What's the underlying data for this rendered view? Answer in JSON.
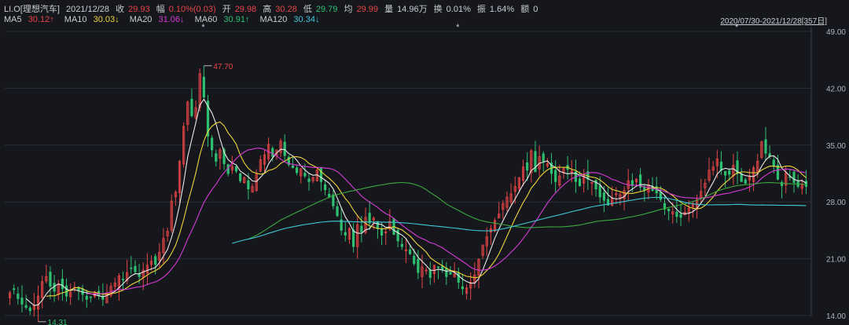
{
  "header": {
    "symbol": "LI.O[理想汽车]",
    "date": "2021/12/28",
    "close_label": "收",
    "close": "29.93",
    "change_label": "幅",
    "change": "0.10%(0.03)",
    "open_label": "开",
    "open": "29.98",
    "high_label": "高",
    "high": "30.28",
    "low_label": "低",
    "low": "29.79",
    "avg_label": "均",
    "avg": "29.99",
    "volume_label": "量",
    "volume": "14.96万",
    "turnover_label": "换",
    "turnover": "0.01%",
    "amplitude_label": "振",
    "amplitude": "1.64%",
    "amount_label": "额",
    "amount": "0"
  },
  "ma_legend": [
    {
      "name": "MA5",
      "value": "30.12↑",
      "color": "#e9e9e9",
      "value_color": "#e64545"
    },
    {
      "name": "MA10",
      "value": "30.03↓",
      "color": "#e9e9e9",
      "value_color": "#f0d43a"
    },
    {
      "name": "MA20",
      "value": "31.06↓",
      "color": "#e9e9e9",
      "value_color": "#d63ad6"
    },
    {
      "name": "MA60",
      "value": "30.91↑",
      "color": "#e9e9e9",
      "value_color": "#2fbf71"
    },
    {
      "name": "MA120",
      "value": "30.34↓",
      "color": "#e9e9e9",
      "value_color": "#40c8d8"
    }
  ],
  "date_range": "2020/07/30-2021/12/28[357日]",
  "chart_data": {
    "type": "candlestick",
    "y_ticks": [
      "49.00",
      "42.00",
      "35.00",
      "28.00",
      "21.00",
      "14.00"
    ],
    "ylim": [
      14,
      49
    ],
    "annotations": {
      "high": "47.70",
      "low": "14.31"
    },
    "star_marker": "*",
    "colors": {
      "up": "#e64545",
      "down": "#2fbf71",
      "ma5": "#e9e9e9",
      "ma10": "#f0d43a",
      "ma20": "#d63ad6",
      "ma60": "#3da83d",
      "ma120": "#40c8d8",
      "grid": "#2a2e37"
    },
    "closes": [
      16.8,
      17.2,
      16.1,
      15.4,
      15.0,
      14.6,
      15.2,
      16.4,
      18.2,
      18.8,
      17.6,
      17.0,
      17.9,
      17.3,
      16.4,
      16.9,
      17.5,
      17.1,
      16.6,
      16.0,
      16.3,
      16.8,
      16.5,
      16.0,
      16.7,
      17.6,
      18.0,
      18.9,
      18.4,
      19.3,
      19.8,
      19.4,
      18.8,
      19.6,
      20.2,
      20.7,
      20.3,
      21.8,
      23.5,
      24.4,
      28.1,
      29.2,
      33.0,
      37.3,
      40.3,
      38.6,
      39.6,
      43.8,
      40.9,
      36.1,
      34.4,
      33.0,
      34.4,
      32.7,
      31.5,
      32.4,
      31.8,
      30.6,
      31.0,
      29.6,
      29.9,
      31.4,
      33.2,
      33.8,
      35.1,
      33.6,
      34.4,
      35.5,
      33.7,
      32.6,
      32.2,
      31.6,
      32.1,
      31.2,
      30.5,
      31.0,
      31.9,
      30.5,
      29.5,
      28.6,
      27.5,
      26.3,
      24.5,
      23.9,
      24.7,
      22.5,
      25.2,
      24.3,
      26.1,
      25.4,
      26.0,
      24.7,
      23.9,
      24.3,
      25.6,
      24.0,
      23.2,
      22.5,
      22.1,
      21.6,
      20.4,
      19.3,
      20.0,
      19.6,
      18.7,
      20.2,
      20.0,
      19.6,
      18.8,
      19.1,
      19.1,
      18.1,
      17.3,
      17.4,
      18.1,
      19.0,
      20.9,
      22.7,
      23.7,
      24.7,
      25.7,
      26.5,
      27.8,
      28.6,
      29.0,
      29.9,
      31.0,
      32.3,
      31.9,
      34.3,
      31.7,
      33.6,
      33.0,
      32.7,
      31.5,
      30.5,
      31.2,
      32.1,
      32.0,
      31.8,
      30.5,
      30.0,
      31.3,
      30.8,
      30.4,
      29.6,
      28.6,
      28.2,
      27.6,
      28.4,
      29.0,
      28.9,
      29.4,
      30.6,
      30.0,
      30.8,
      29.8,
      29.5,
      30.1,
      29.4,
      29.1,
      28.3,
      27.1,
      26.9,
      26.8,
      26.2,
      26.1,
      26.7,
      27.2,
      27.8,
      28.3,
      29.3,
      30.3,
      31.9,
      32.3,
      33.3,
      31.9,
      31.3,
      31.4,
      32.5,
      31.5,
      30.5,
      30.3,
      31.1,
      32.2,
      33.0,
      35.4,
      34.0,
      33.6,
      32.4,
      30.8,
      30.0,
      31.6,
      31.1,
      30.4,
      29.9,
      30.2,
      29.9
    ],
    "ma5_values": "computed from closes",
    "ma120_start_index": 55
  }
}
